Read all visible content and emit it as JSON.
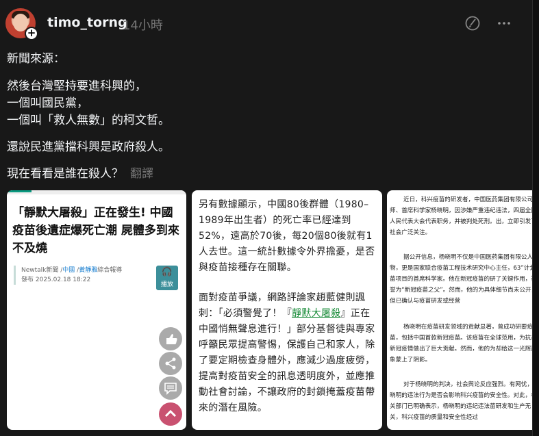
{
  "post": {
    "username": "timo_torng",
    "time": "14小時",
    "lines": [
      "新聞來源：",
      "然後台灣堅持要進科興的，",
      "一個叫國民黨，",
      "一個叫「救人無數」的柯文哲。",
      "還說民進黨擋科興是政府殺人。",
      "現在看看是誰在殺人？"
    ],
    "translate_label": "翻譯"
  },
  "card1": {
    "title": "「靜默大屠殺」正在發生! 中國疫苗後遺症爆死亡潮 屍體多到來不及燒",
    "meta_source": "Newtalk新聞",
    "meta_section": "中國",
    "meta_author": "黃靜雅",
    "meta_suffix": "綜合報導",
    "meta_date": "發布 2025.02.18 18:22",
    "listen_label": "播放"
  },
  "card2": {
    "para1": "另有數據顯示，中國80後群體（1980–1989年出生者）的死亡率已經達到52%，遠高於70後，每20個80後就有1人去世。這一統計數據令外界擔憂，是否與疫苗接種存在關聯。",
    "para2_a": "面對疫苗爭議，網路評論家趙藍健則諷刺：「必須警覺了！『",
    "para2_link": "靜默大屠殺",
    "para2_b": "』正在中國悄無聲息進行！」部分基督徒與專家呼籲民眾提高警惕，保護自己和家人，除了要定期檢查身體外，應減少過度疲勞，提高對疫苗安全的訊息透明度外，並應推動社會討論，不讓政府的封鎖掩蓋疫苗帶來的潛在風險。"
  },
  "card3": {
    "p1": "近日，科兴疫苗的研发者，中国医药集团有限公司程师、首席科学家杨晓明，因涉嫌严重违纪违法，四届全国人民代表大会代表职务，并被判处死刑。出，立即引发了社会广泛关注。",
    "p2": "据公开信息，杨晓明不仅是中国医药集团有限公人物，更是国家联合疫苗工程技术研究中心主任，63”计划疫苗项目的首席科学家。他在新冠疫苗的研了关键作用，被誉为“新冠疫苗之父”。然而，他的为具体细节尚未公开，但已确认与疫苗研发或经营",
    "p3": "杨晓明在疫苗研发领域的贡献显著，曾成功研要疫苗，包括中国首款新冠疫苗。该疫苗在全球范用，为抗击新冠疫情做出了巨大贡献。然而，他的为却给这一光辉形象蒙上了阴影。",
    "p4": "对于杨晓明的判决，社会舆论反应强烈。有网忧，杨晓明的违法行为是否会影响科兴疫苗的安全性。对此，相关部门已明确表示，杨晓明的违纪违法苗研发和生产无关，科兴疫苗的质量和安全性经过"
  }
}
